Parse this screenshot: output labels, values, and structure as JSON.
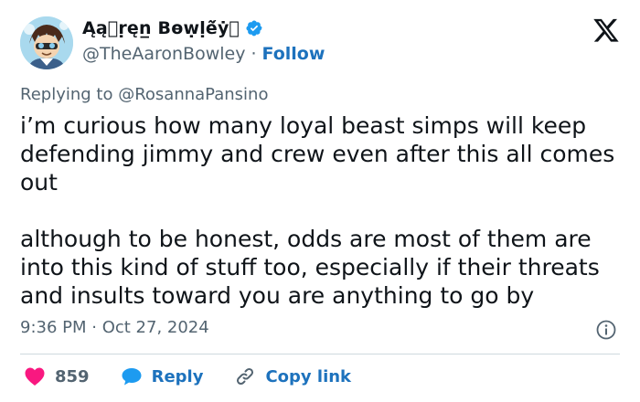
{
  "author": {
    "display_name": "Ąą⃝ṛęn̲ Bɵẉḷẽ̌ẏ⃝",
    "handle": "@TheAaronBowley",
    "separator": "·",
    "follow_label": "Follow"
  },
  "tweet": {
    "replying_prefix": "Replying to",
    "replying_to": "@RosannaPansino",
    "paragraphs": [
      "i’m curious how many loyal beast simps will keep defending jimmy and crew even after this all comes out",
      "although to be honest, odds are most of them are into this kind of stuff too, especially if their threats and insults toward you are anything to go by"
    ],
    "timestamp": "9:36 PM · Oct 27, 2024"
  },
  "actions": {
    "like_count": "859",
    "reply_label": "Reply",
    "copy_link_label": "Copy link"
  },
  "colors": {
    "accent": "#1d9bf0",
    "like": "#f91880",
    "muted": "#536471"
  },
  "icons": [
    "verified-badge-icon",
    "x-logo-icon",
    "info-icon",
    "heart-icon",
    "reply-bubble-icon",
    "link-icon"
  ]
}
